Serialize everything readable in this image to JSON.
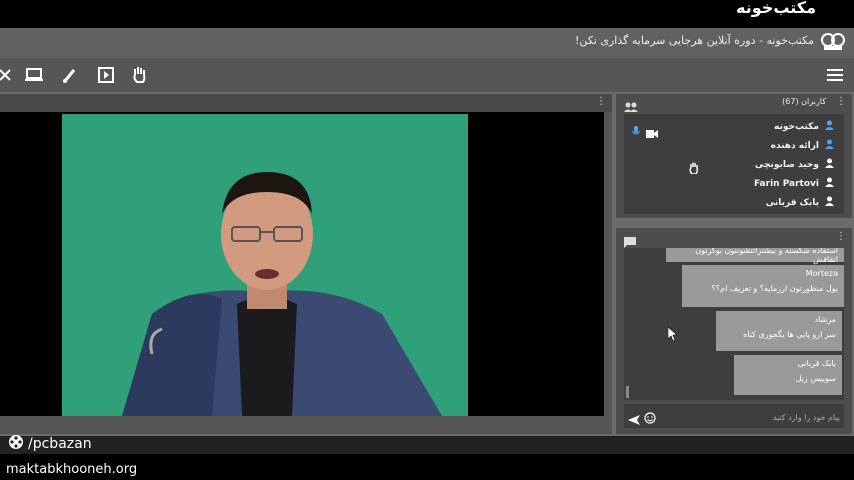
{
  "window": {
    "title": "مکتب‌خونه - دوره آنلاین هرجایی سرمایه گذاری نکن!",
    "brand": "مکتب‌خونه"
  },
  "toolbar": {
    "icons": [
      "close-icon",
      "screen-share-icon",
      "brush-icon",
      "play-icon",
      "hand-icon"
    ],
    "menu_icon": "menu-icon"
  },
  "users": {
    "header": "کاربران (67)",
    "list": [
      {
        "name": "مکتب‌خونه",
        "status_icons": [
          "mic-icon",
          "camera-icon"
        ],
        "color": "#4ba3ff"
      },
      {
        "name": "ارائه دهنده",
        "status_icons": [],
        "color": "#4ba3ff"
      },
      {
        "name": "وحید صابونچی",
        "status_icons": [
          "hand-icon"
        ],
        "color": "#ffffff"
      },
      {
        "name": "Farin Partovi",
        "status_icons": [],
        "color": "#ffffff"
      },
      {
        "name": "بابک قربانی",
        "status_icons": [],
        "color": "#ffffff"
      }
    ]
  },
  "chat": {
    "messages": [
      {
        "name": "",
        "text": "استفاده شکسته و بیشتراتتشوننون بوکرتون اتقاقش"
      },
      {
        "name": "Morteza",
        "text": "پول منظورتون ارزمایه؟ و تعریف ام؟؟"
      },
      {
        "name": "مرشاد",
        "text": "سر ارو پایی ها یگجوری کناه"
      },
      {
        "name": "بابک قربانی",
        "text": "سوییس زیل"
      }
    ],
    "input_placeholder": "پیام خود را وارد کنید"
  },
  "watermark": {
    "handle": "/pcbazan",
    "site": "maktabkhooneh.org"
  },
  "colors": {
    "green_screen": "#2fa07a",
    "accent_blue": "#4ba3ff"
  }
}
